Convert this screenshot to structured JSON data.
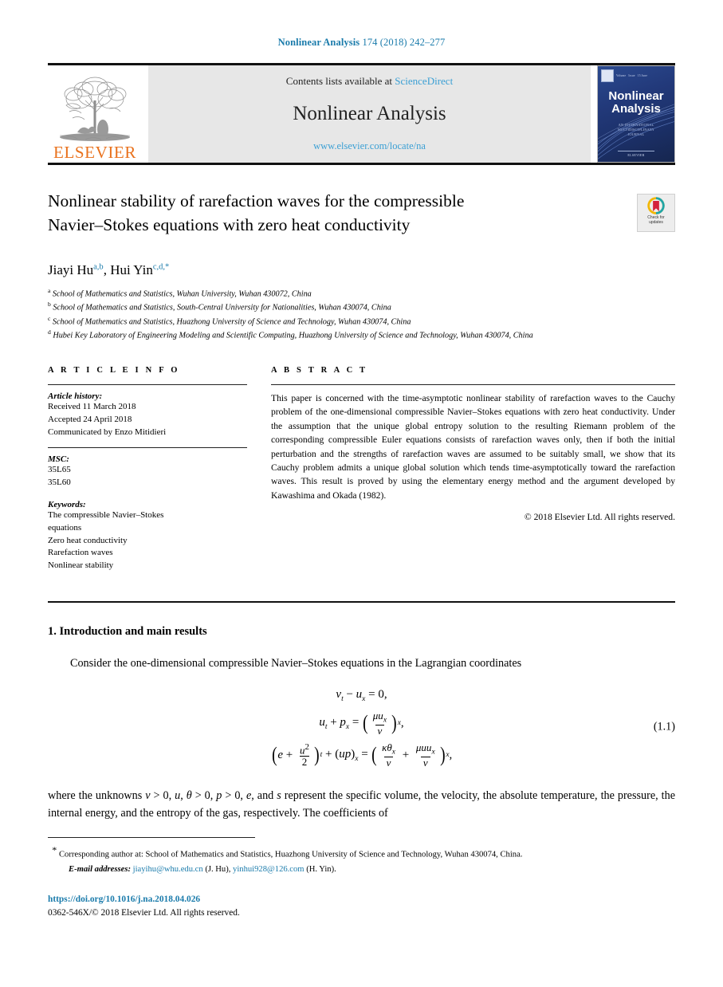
{
  "running_head": {
    "journal": "Nonlinear Analysis",
    "volume_info": "174 (2018) 242–277",
    "color": "#1a7bab"
  },
  "masthead": {
    "publisher": "ELSEVIER",
    "publisher_color": "#E9711C",
    "contents_prefix": "Contents lists available at ",
    "contents_link": "ScienceDirect",
    "journal_name": "Nonlinear Analysis",
    "journal_url": "www.elsevier.com/locate/na",
    "link_color": "#3a9fd4",
    "cover": {
      "title_line1": "Nonlinear",
      "title_line2": "Analysis",
      "meta_left": "Volume",
      "meta_mid": "Issue",
      "meta_right": "15 June",
      "sub_line1": "AN INTERNATIONAL",
      "sub_line2": "MULTIDISCIPLINARY",
      "sub_line3": "JOURNAL",
      "foot": "ELSEVIER",
      "background_color": "#22397a"
    }
  },
  "article": {
    "title_line1": "Nonlinear stability of rarefaction waves for the compressible",
    "title_line2": "Navier–Stokes equations with zero heat conductivity",
    "crossmark": {
      "line1": "Check for",
      "line2": "updates"
    },
    "authors": [
      {
        "name": "Jiayi Hu",
        "marks": "a,b"
      },
      {
        "name": "Hui Yin",
        "marks": "c,d,",
        "asterisk": "*"
      }
    ],
    "authors_separator": ", ",
    "affiliations": [
      {
        "mark": "a",
        "text": "School of Mathematics and Statistics, Wuhan University, Wuhan 430072, China"
      },
      {
        "mark": "b",
        "text": "School of Mathematics and Statistics, South-Central University for Nationalities, Wuhan 430074, China"
      },
      {
        "mark": "c",
        "text": "School of Mathematics and Statistics, Huazhong University of Science and Technology, Wuhan 430074, China"
      },
      {
        "mark": "d",
        "text": "Hubei Key Laboratory of Engineering Modeling and Scientific Computing, Huazhong University of Science and Technology, Wuhan 430074, China"
      }
    ]
  },
  "article_info": {
    "heading": "A R T I C L E   I N F O",
    "history_label": "Article history:",
    "received": "Received 11 March 2018",
    "accepted": "Accepted 24 April 2018",
    "communicated": "Communicated by Enzo Mitidieri",
    "msc_label": "MSC:",
    "msc_codes": [
      "35L65",
      "35L60"
    ],
    "keywords_label": "Keywords:",
    "keywords": [
      "The compressible Navier–Stokes",
      "equations",
      "Zero heat conductivity",
      "Rarefaction waves",
      "Nonlinear stability"
    ]
  },
  "abstract": {
    "heading": "A B S T R A C T",
    "text": "This paper  is concerned with the time-asymptotic nonlinear stability of rarefaction waves to the Cauchy problem of the one-dimensional compressible Navier–Stokes equations with zero heat conductivity. Under the assumption that the unique global entropy solution to the resulting Riemann problem of the corresponding compressible Euler equations consists of rarefaction waves only, then if both the initial perturbation and the strengths of rarefaction waves are assumed to be suitably small, we show that its Cauchy problem admits a unique global solution which tends time-asymptotically toward the rarefaction waves. This result is proved by using the elementary energy method and the argument developed by Kawashima and Okada (1982).",
    "copyright": "© 2018 Elsevier Ltd. All rights reserved."
  },
  "body": {
    "section_title": "1. Introduction and main results",
    "paragraph1": "Consider the one-dimensional compressible Navier–Stokes equations in the Lagrangian coordinates",
    "equation_number": "(1.1)",
    "equation": {
      "line1": "vt − ux = 0,",
      "line2": "ut + px = (μux / v)x,",
      "line3": "(e + u²/2)t + (up)x = (κθx / v + μuux / v)x,"
    },
    "paragraph2": "where the unknowns v > 0, u, θ > 0, p > 0, e, and s represent the specific volume, the velocity, the absolute temperature, the pressure, the internal energy, and the entropy of the gas, respectively. The coefficients of"
  },
  "footnotes": {
    "corresponding": "Corresponding author at: School of Mathematics and Statistics, Huazhong University of Science and Technology, Wuhan 430074, China.",
    "corresponding_marker": "*",
    "email_label": "E-mail addresses:",
    "emails": [
      {
        "address": "jiayihu@whu.edu.cn",
        "owner": "(J. Hu)"
      },
      {
        "address": "yinhui928@126.com",
        "owner": "(H. Yin)"
      }
    ],
    "doi": "https://doi.org/10.1016/j.na.2018.04.026",
    "issn_line": "0362-546X/© 2018 Elsevier Ltd. All rights reserved."
  }
}
